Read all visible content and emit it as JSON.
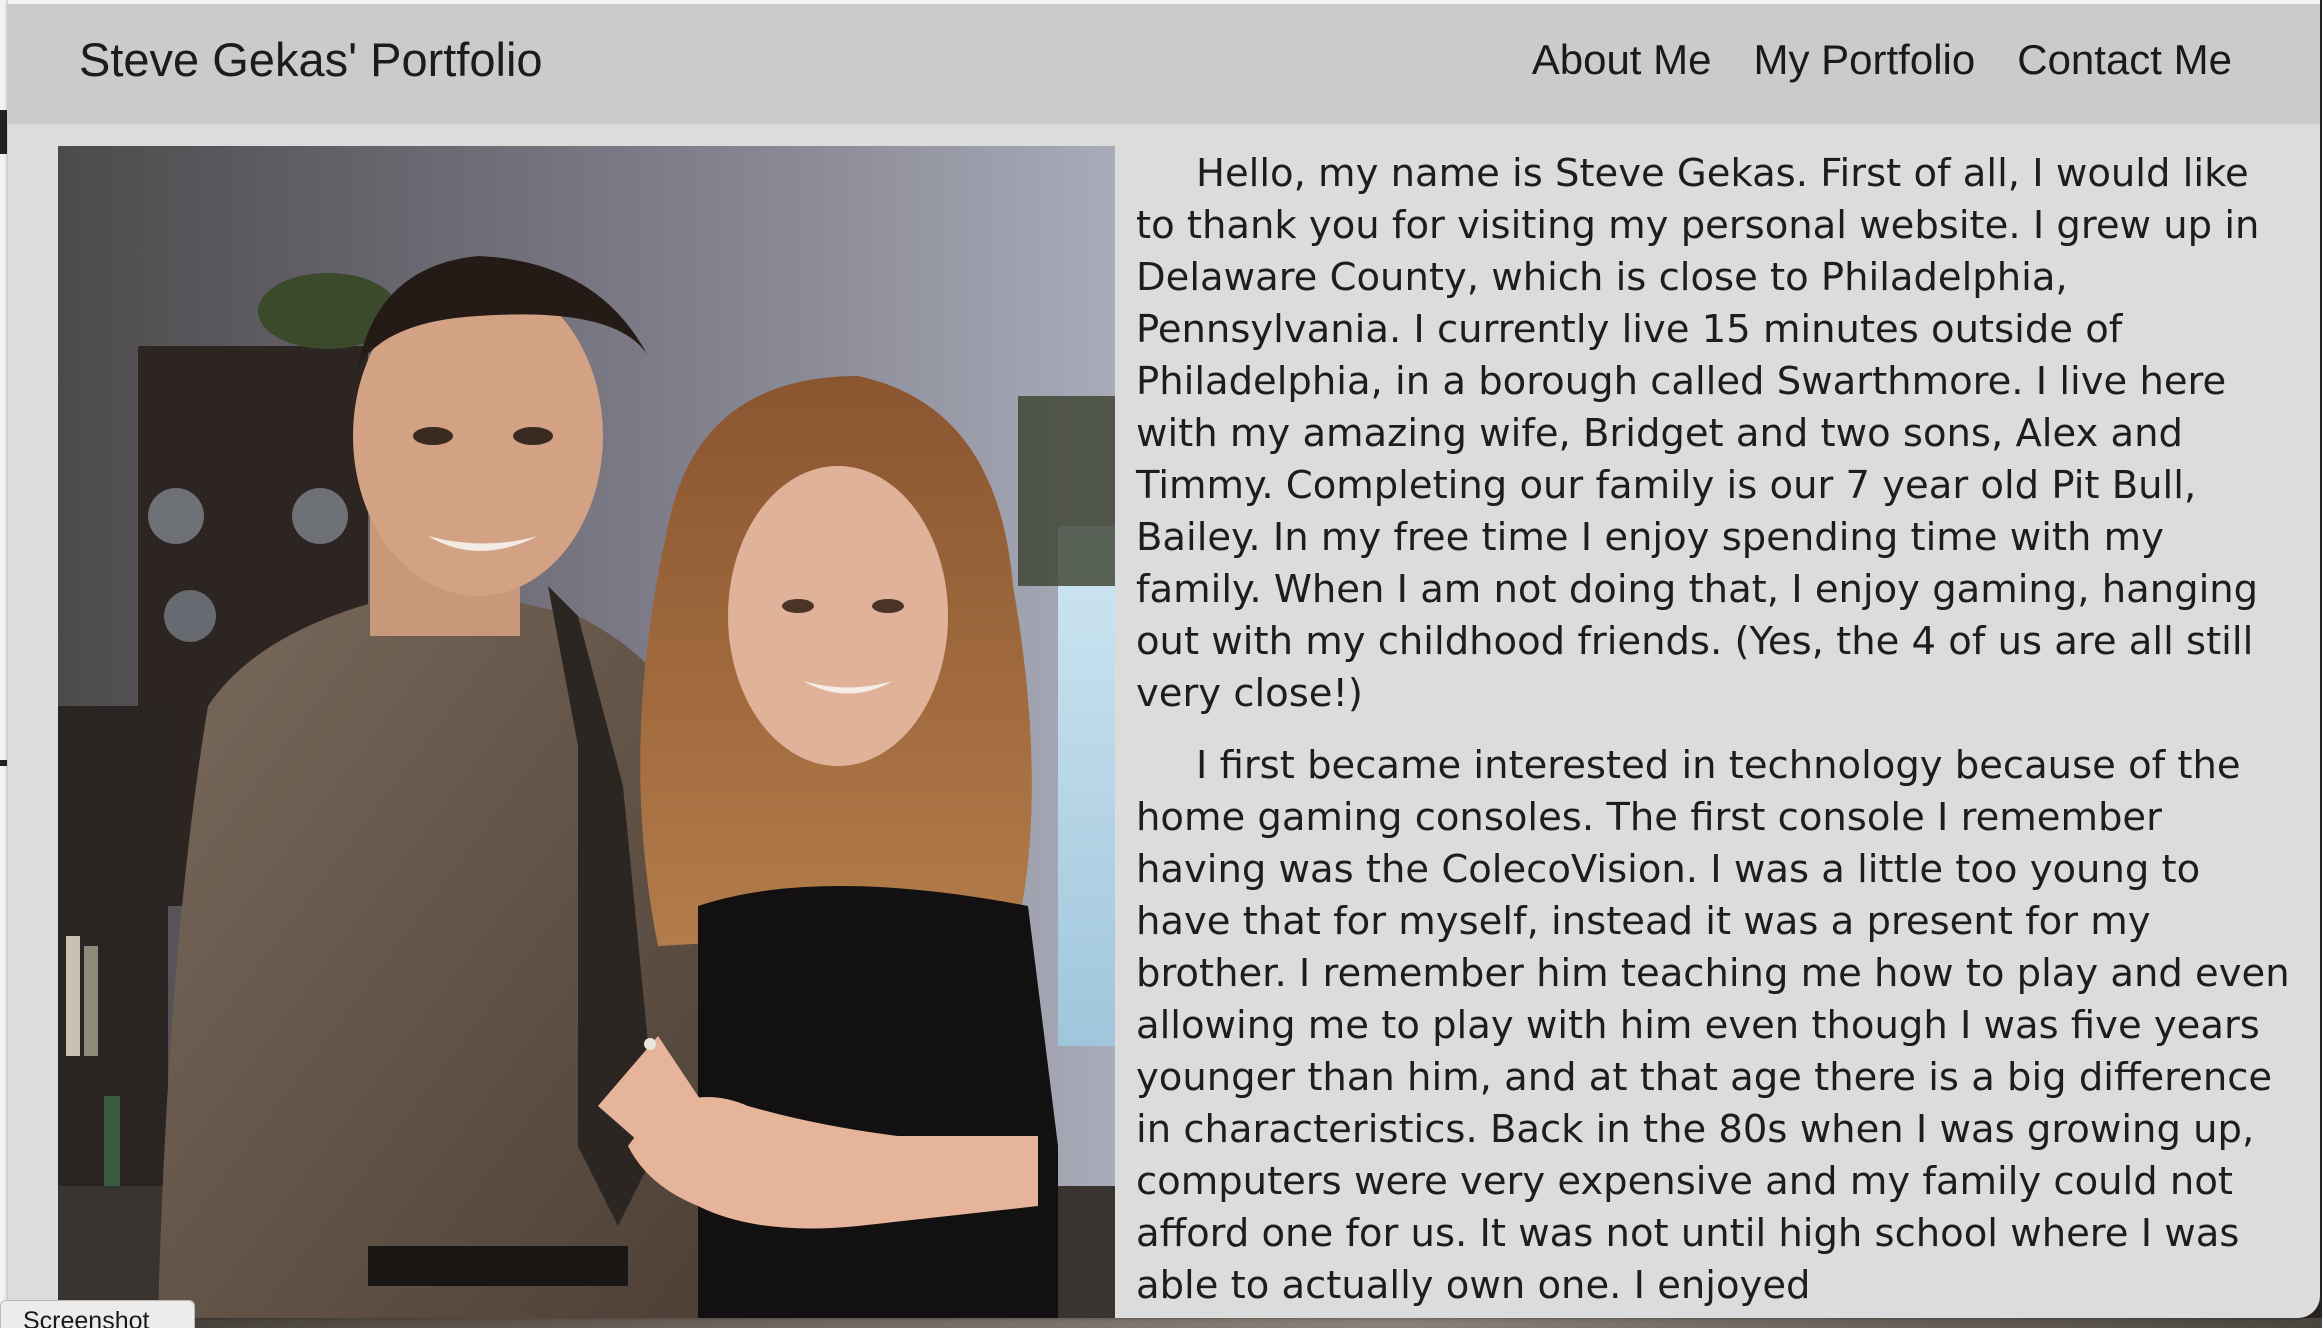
{
  "navbar": {
    "brand": "Steve Gekas' Portfolio",
    "links": [
      {
        "label": "About Me"
      },
      {
        "label": "My Portfolio"
      },
      {
        "label": "Contact Me"
      }
    ]
  },
  "bio": {
    "paragraphs": [
      "Hello, my name is Steve Gekas. First of all, I would like to thank you for visiting my personal website. I grew up in Delaware County, which is close to Philadelphia, Pennsylvania. I currently live 15 minutes outside of Philadelphia, in a borough called Swarthmore. I live here with my amazing wife, Bridget and two sons, Alex and Timmy. Completing our family is our 7 year old Pit Bull, Bailey. In my free time I enjoy spending time with my family. When I am not doing that, I enjoy gaming, hanging out with my childhood friends. (Yes, the 4 of us are all still very close!)",
      "I first became interested in technology because of the home gaming consoles. The first console I remember having was the ColecoVision. I was a little too young to have that for myself, instead it was a present for my brother. I remember him teaching me how to play and even allowing me to play with him even though I was five years younger than him, and at that age there is a big difference in characteristics. Back in the 80s when I was growing up, computers were very expensive and my family could not afford one for us. It was not until high school where I was able to actually own one. I enjoyed"
    ]
  },
  "taskbar": {
    "label": "Screenshot"
  },
  "colors": {
    "page_background": "#dcdcdc",
    "navbar_background": "#cbcbcb",
    "text": "#1d1d1d"
  }
}
